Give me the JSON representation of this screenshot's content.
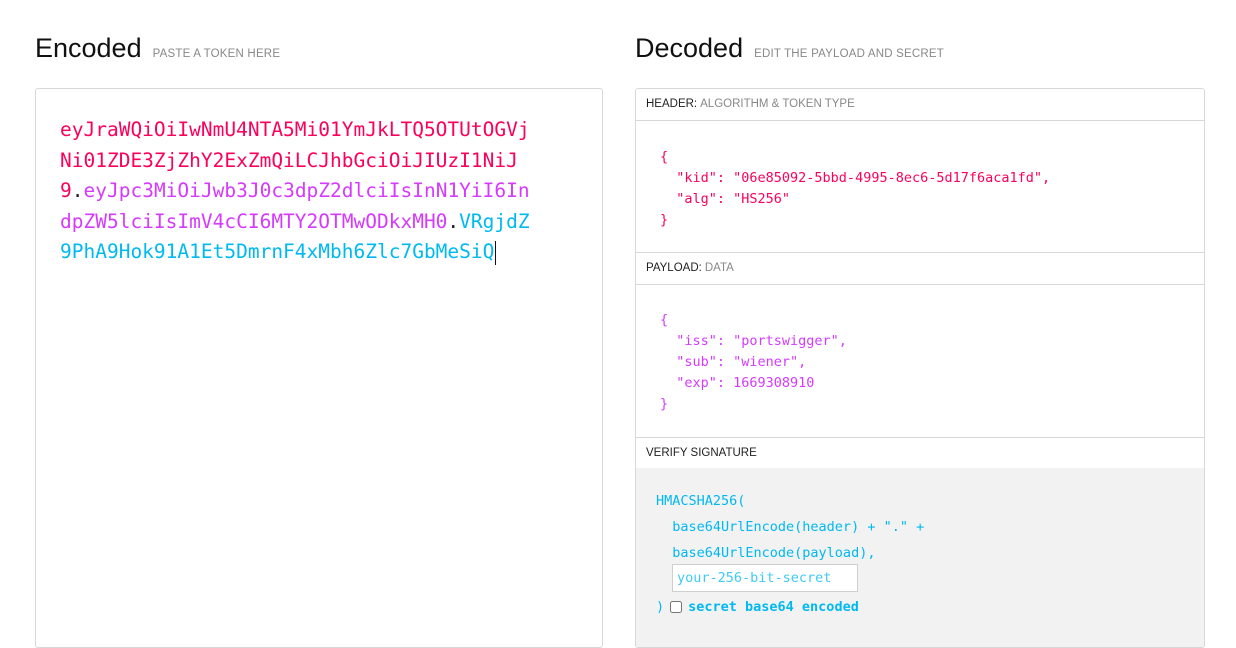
{
  "encoded": {
    "title": "Encoded",
    "subtitle": "PASTE A TOKEN HERE",
    "token_header": "eyJraWQiOiIwNmU4NTA5Mi01YmJkLTQ5OTUtOGVjNi01ZDE3ZjZhY2ExZmQiLCJhbGciOiJIUzI1NiJ9",
    "dot1": ".",
    "token_payload": "eyJpc3MiOiJwb3J0c3dpZ2dlciIsInN1YiI6IndpZW5lciIsImV4cCI6MTY2OTMwODkxMH0",
    "dot2": ".",
    "token_signature": "VRgjdZ9PhA9Hok91A1Et5DmrnF4xMbh6Zlc7GbMeSiQ"
  },
  "decoded": {
    "title": "Decoded",
    "subtitle": "EDIT THE PAYLOAD AND SECRET",
    "header_section": {
      "label": "HEADER:",
      "hint": "ALGORITHM & TOKEN TYPE",
      "json": "{\n  \"kid\": \"06e85092-5bbd-4995-8ec6-5d17f6aca1fd\",\n  \"alg\": \"HS256\"\n}"
    },
    "payload_section": {
      "label": "PAYLOAD:",
      "hint": "DATA",
      "json": "{\n  \"iss\": \"portswigger\",\n  \"sub\": \"wiener\",\n  \"exp\": 1669308910\n}"
    },
    "verify_section": {
      "label": "VERIFY SIGNATURE",
      "code": "HMACSHA256(\n  base64UrlEncode(header) + \".\" +\n  base64UrlEncode(payload),",
      "secret_placeholder": "your-256-bit-secret",
      "close_paren": ")",
      "base64_label": "secret base64 encoded",
      "base64_checked": false
    }
  },
  "colors": {
    "header": "#fb015b",
    "payload": "#d63aff",
    "signature": "#00b9f1"
  }
}
